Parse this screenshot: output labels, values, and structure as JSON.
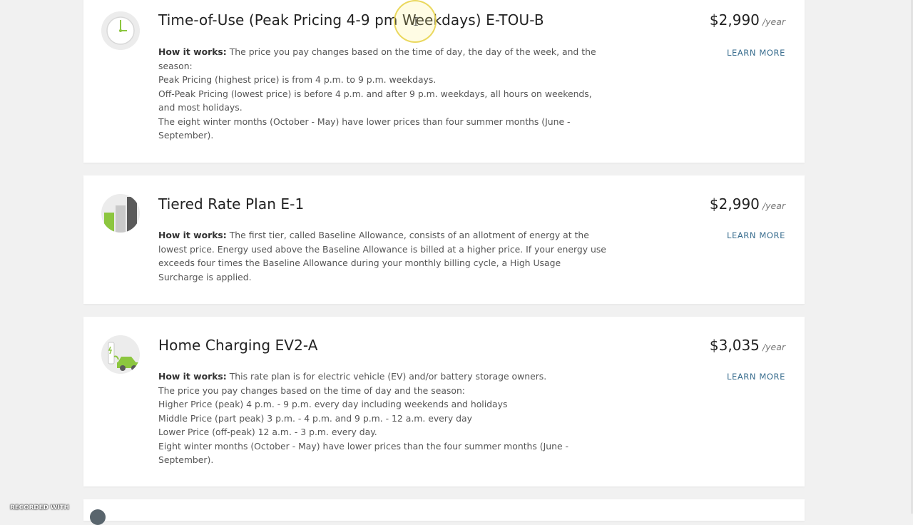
{
  "plans": [
    {
      "title": "Time-of-Use (Peak Pricing 4-9 pm Weekdays) E-TOU-B",
      "icon": "clock-icon",
      "how_label": "How it works:",
      "lines": [
        "The price you pay changes based on the time of day, the day of the week, and the",
        "season:",
        "Peak Pricing (highest price) is from 4 p.m. to 9 p.m. weekdays.",
        "Off-Peak Pricing (lowest price) is before 4 p.m. and after 9 p.m. weekdays, all hours on weekends,",
        "and most holidays.",
        "The eight winter months (October - May) have lower prices than four summer months (June -",
        "September)."
      ],
      "price": "$2,990",
      "per": "/year",
      "learn_more": "LEARN MORE"
    },
    {
      "title": "Tiered Rate Plan E-1",
      "icon": "tiered-bars-icon",
      "how_label": "How it works:",
      "lines": [
        "The first tier, called Baseline Allowance, consists of an allotment of energy at the",
        "lowest price. Energy used above the Baseline Allowance is billed at a higher price. If your energy use",
        "exceeds four times the Baseline Allowance during your monthly billing cycle, a High Usage",
        "Surcharge is applied."
      ],
      "price": "$2,990",
      "per": "/year",
      "learn_more": "LEARN MORE"
    },
    {
      "title": "Home Charging EV2-A",
      "icon": "ev-charging-icon",
      "how_label": "How it works:",
      "lines": [
        "This rate plan is for electric vehicle (EV) and/or battery storage owners.",
        "The price you pay changes based on the time of day and the season:",
        "Higher Price (peak) 4 p.m. - 9 p.m. every day including weekends and holidays",
        "Middle Price (part peak) 3 p.m. - 4 p.m. and 9 p.m. - 12 a.m. every day",
        "Lower Price (off-peak) 12 a.m. - 3 p.m. every day.",
        "Eight winter months (October - May) have lower prices than the four summer months (June -",
        "September)."
      ],
      "price": "$3,035",
      "per": "/year",
      "learn_more": "LEARN MORE"
    }
  ],
  "watermark": "RECORDED WITH",
  "colors": {
    "background": "#f1f1f1",
    "card": "#ffffff",
    "link": "#3a6e8f",
    "accent_green": "#8cc63f"
  }
}
